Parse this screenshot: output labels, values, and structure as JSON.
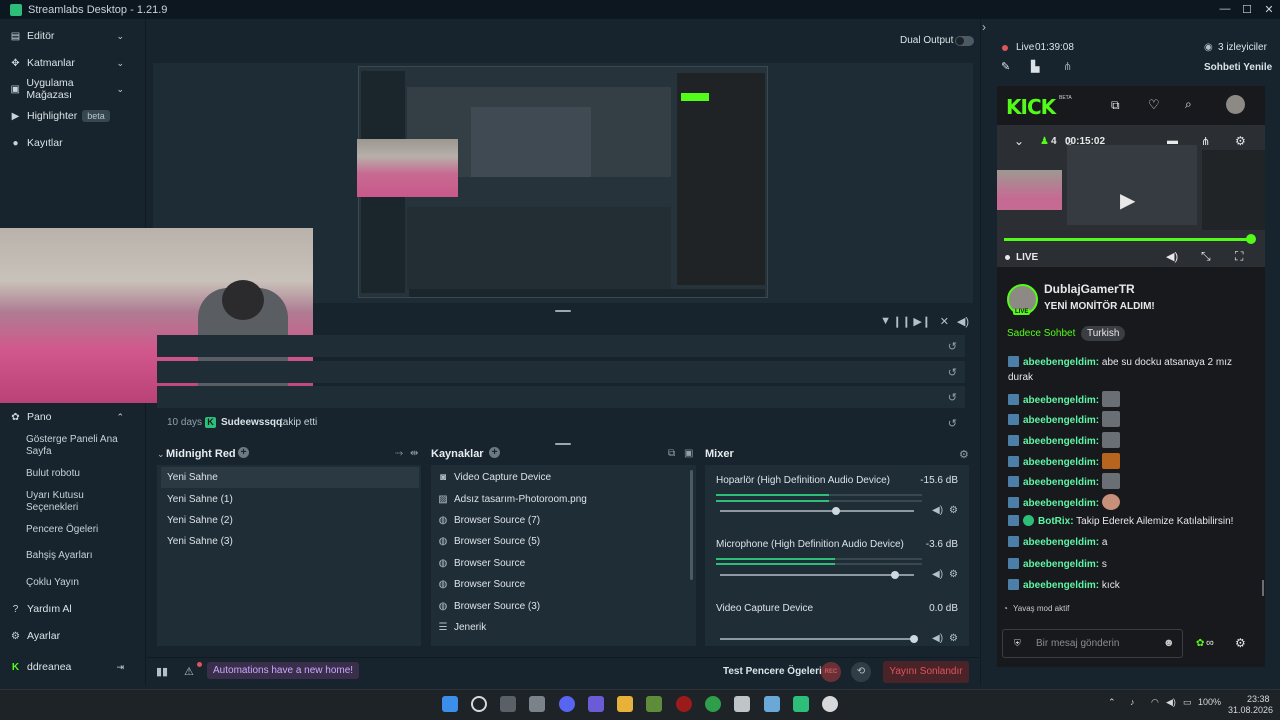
{
  "window": {
    "title": "Streamlabs Desktop - 1.21.9",
    "controls": [
      "—",
      "☐",
      "✕"
    ]
  },
  "sidebar": {
    "items": [
      {
        "label": "Editör",
        "icon": "editor-icon",
        "chevron": "⌄"
      },
      {
        "label": "Katmanlar",
        "icon": "layers-icon",
        "chevron": "⌄"
      },
      {
        "label": "Uygulama Mağazası",
        "icon": "store-icon",
        "chevron": "⌄"
      },
      {
        "label": "Highlighter",
        "icon": "highlighter-icon",
        "badge": "beta"
      },
      {
        "label": "Kayıtlar",
        "icon": "recordings-icon"
      }
    ],
    "dashboard": {
      "label": "Pano",
      "icon": "dashboard-icon",
      "chevron": "⌃",
      "subitems": [
        "Gösterge Paneli Ana Sayfa",
        "Bulut robotu",
        "Uyarı Kutusu Seçenekleri",
        "Pencere Ögeleri",
        "Bahşiş Ayarları",
        "Çoklu Yayın"
      ]
    },
    "help": "Yardım Al",
    "settings": "Ayarlar",
    "user": "ddreanea"
  },
  "header": {
    "dual_output": "Dual Output"
  },
  "activity": {
    "last_event": {
      "time": "10 days",
      "user": "Sudeewssqq",
      "action": "takip etti"
    }
  },
  "scenes": {
    "title": "Midnight Red",
    "items": [
      "Yeni Sahne",
      "Yeni Sahne (1)",
      "Yeni Sahne (2)",
      "Yeni Sahne (3)"
    ],
    "selected": "Yeni Sahne"
  },
  "sources": {
    "title": "Kaynaklar",
    "items": [
      {
        "label": "Video Capture Device",
        "icon": "camera-icon"
      },
      {
        "label": "Adsız tasarım-Photoroom.png",
        "icon": "image-icon"
      },
      {
        "label": "Browser Source (7)",
        "icon": "globe-icon"
      },
      {
        "label": "Browser Source (5)",
        "icon": "globe-icon"
      },
      {
        "label": "Browser Source",
        "icon": "globe-icon"
      },
      {
        "label": "Browser Source",
        "icon": "globe-icon"
      },
      {
        "label": "Browser Source (3)",
        "icon": "globe-icon"
      },
      {
        "label": "Jenerik",
        "icon": "text-icon"
      }
    ]
  },
  "mixer": {
    "title": "Mixer",
    "channels": [
      {
        "name": "Hoparlör (High Definition Audio Device)",
        "db": "-15.6 dB",
        "level": 0.55,
        "volume": 0.6
      },
      {
        "name": "Microphone (High Definition Audio Device)",
        "db": "-3.6 dB",
        "level": 0.58,
        "volume": 0.9
      },
      {
        "name": "Video Capture Device",
        "db": "0.0 dB",
        "level": 0.0,
        "volume": 1.0
      }
    ]
  },
  "bottom": {
    "automations": "Automations have a new home!",
    "test_widgets": "Test Pencere Ögeleri",
    "rec": "REC",
    "end_stream": "Yayını Sonlandır"
  },
  "chat": {
    "live_label": "Live",
    "live_time": "01:39:08",
    "viewers": "3 izleyiciler",
    "refresh": "Sohbeti Yenile",
    "kick_logo": "KICK",
    "kick_beta": "BETA",
    "player": {
      "viewers": "4",
      "uptime": "00:15:02",
      "live": "LIVE"
    },
    "streamer": {
      "name": "DublajGamerTR",
      "title": "YENİ MONİTÖR ALDIM!",
      "live_badge": "LIVE"
    },
    "tags": [
      "Sadece Sohbet",
      "Turkish"
    ],
    "messages": [
      {
        "user": "abeebengeldim:",
        "text": " abe su docku atsanaya 2 mız durak",
        "emote": false
      },
      {
        "user": "abeebengeldim:",
        "text": "",
        "emote": true
      },
      {
        "user": "abeebengeldim:",
        "text": "",
        "emote": true
      },
      {
        "user": "abeebengeldim:",
        "text": "",
        "emote": true
      },
      {
        "user": "abeebengeldim:",
        "text": "",
        "emote": true
      },
      {
        "user": "abeebengeldim:",
        "text": "",
        "emote": true
      },
      {
        "user": "abeebengeldim:",
        "text": "",
        "emote": true
      },
      {
        "user": "BotRix:",
        "text": " Takip Ederek Ailemize Katılabilirsin!",
        "emote": false,
        "bot": true
      },
      {
        "user": "abeebengeldim:",
        "text": " a",
        "emote": false
      },
      {
        "user": "abeebengeldim:",
        "text": " s",
        "emote": false
      },
      {
        "user": "abeebengeldim:",
        "text": " kıck",
        "emote": false
      }
    ],
    "slow_mode": "Yavaş mod aktif",
    "input_placeholder": "Bir mesaj gönderin"
  },
  "taskbar": {
    "clock_time": "23:38",
    "clock_date": "31.08.2026",
    "battery": "100%"
  },
  "colors": {
    "accent": "#2dbf7a",
    "kick_green": "#53fc18",
    "bg": "#17242d",
    "panel": "#1f2d36",
    "end_stream": "#e0555b"
  }
}
